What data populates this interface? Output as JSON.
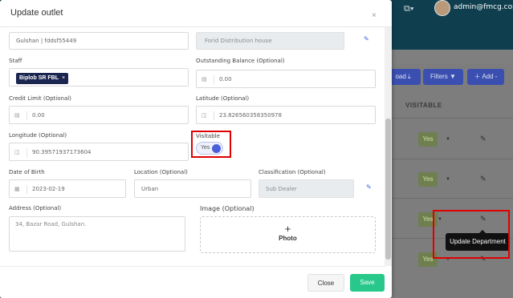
{
  "app": {
    "user_email": "admin@fmcg.com",
    "topbar_icon": "copy-icon",
    "toolbar": {
      "upload_label": "oad",
      "filters_label": "Filters",
      "add_label": "Add -"
    },
    "table": {
      "header_visitable": "VISITABLE",
      "rows": [
        {
          "visitable": "Yes"
        },
        {
          "visitable": "Yes"
        },
        {
          "visitable": "Yes"
        },
        {
          "visitable": "Yes"
        }
      ]
    },
    "tooltip": "Update Department"
  },
  "modal": {
    "title": "Update outlet",
    "close_symbol": "×",
    "outlet_value": "Gulshan | fddsf55449",
    "distribution_house_value": "Forid Distribution house",
    "staff": {
      "label": "Staff",
      "chip": "Biplob SR FBL",
      "chip_remove": "×"
    },
    "outstanding_balance": {
      "label": "Outstanding Balance (Optional)",
      "value": "0.00",
      "icon": "calculator-icon"
    },
    "credit_limit": {
      "label": "Credit Limit (Optional)",
      "value": "0.00",
      "icon": "calculator-icon"
    },
    "latitude": {
      "label": "Latitude (Optional)",
      "value": "23.826560358350978",
      "icon": "map-icon"
    },
    "longitude": {
      "label": "Longitude (Optional)",
      "value": "90.39571937173604",
      "icon": "map-icon"
    },
    "visitable": {
      "label": "Visitable",
      "value": "Yes",
      "checked": true
    },
    "date_of_birth": {
      "label": "Date of Birth",
      "value": "2023-02-19",
      "icon": "calendar-icon"
    },
    "location": {
      "label": "Location (Optional)",
      "value": "Urban"
    },
    "classification": {
      "label": "Classification (Optional)",
      "value": "Sub Dealer"
    },
    "address": {
      "label": "Address (Optional)",
      "placeholder": "34, Bazar Road, Gulshan."
    },
    "image": {
      "label": "Image (Optional)",
      "plus": "+",
      "photo_label": "Photo"
    },
    "buttons": {
      "close": "Close",
      "save": "Save"
    }
  },
  "colors": {
    "accent": "#4a5fd8",
    "save": "#28c88a",
    "highlight": "#e00000",
    "header": "#0f3f4f"
  }
}
